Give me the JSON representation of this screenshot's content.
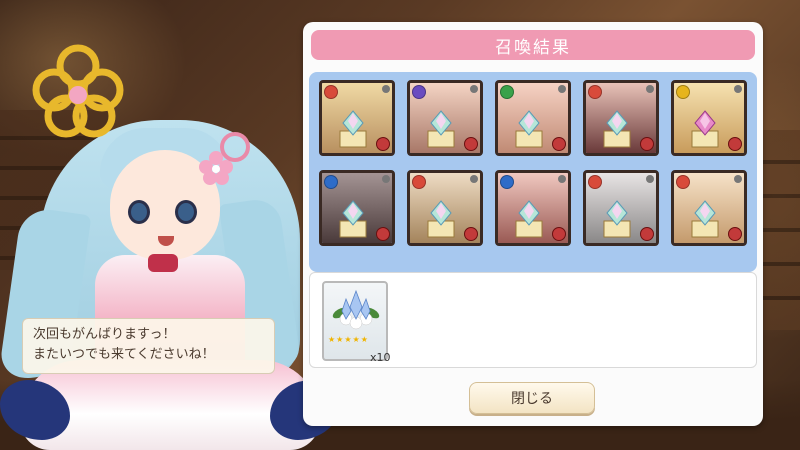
{
  "dialogue": {
    "line1": "次回もがんばりますっ！",
    "line2": "またいつでも来てくださいね！"
  },
  "panel": {
    "title": "召喚結果",
    "results": [
      {
        "element": "fire",
        "element_color": "#d84a3a",
        "gem": "rainbow",
        "portrait_top": "#f0d9a4",
        "portrait_bottom": "#b89060"
      },
      {
        "element": "moon",
        "element_color": "#6a4cc0",
        "gem": "rainbow",
        "portrait_top": "#f4d4c4",
        "portrait_bottom": "#a87868"
      },
      {
        "element": "wind",
        "element_color": "#3aa24a",
        "gem": "rainbow",
        "portrait_top": "#f6d2c4",
        "portrait_bottom": "#c08a74"
      },
      {
        "element": "fire",
        "element_color": "#d84a3a",
        "gem": "rainbow",
        "portrait_top": "#e8c2b8",
        "portrait_bottom": "#6a3a3a"
      },
      {
        "element": "sun",
        "element_color": "#e6b41c",
        "gem": "pink",
        "portrait_top": "#f6e2b0",
        "portrait_bottom": "#c89c5c"
      },
      {
        "element": "water",
        "element_color": "#2e6cc8",
        "gem": "rainbow",
        "portrait_top": "#a49494",
        "portrait_bottom": "#4a3a3a"
      },
      {
        "element": "fire",
        "element_color": "#d84a3a",
        "gem": "rainbow",
        "portrait_top": "#eedcc4",
        "portrait_bottom": "#a4845c"
      },
      {
        "element": "water",
        "element_color": "#2e6cc8",
        "gem": "rainbow",
        "portrait_top": "#f0c8c0",
        "portrait_bottom": "#9a5a54"
      },
      {
        "element": "fire",
        "element_color": "#d84a3a",
        "gem": "rainbow",
        "portrait_top": "#e8e4e4",
        "portrait_bottom": "#8a8888"
      },
      {
        "element": "fire",
        "element_color": "#d84a3a",
        "gem": "rainbow",
        "portrait_top": "#f6e2c8",
        "portrait_bottom": "#c49a6c"
      }
    ],
    "item": {
      "name": "crystal-bouquet-icon",
      "stars": "★★★★★",
      "count": "x10"
    },
    "close_label": "閉じる"
  },
  "colors": {
    "title_bar": "#f09ab3",
    "grid_bg": "#a7c8ef",
    "panel_bg": "#fbfbfb",
    "button_bg": "#f3e4c4"
  }
}
